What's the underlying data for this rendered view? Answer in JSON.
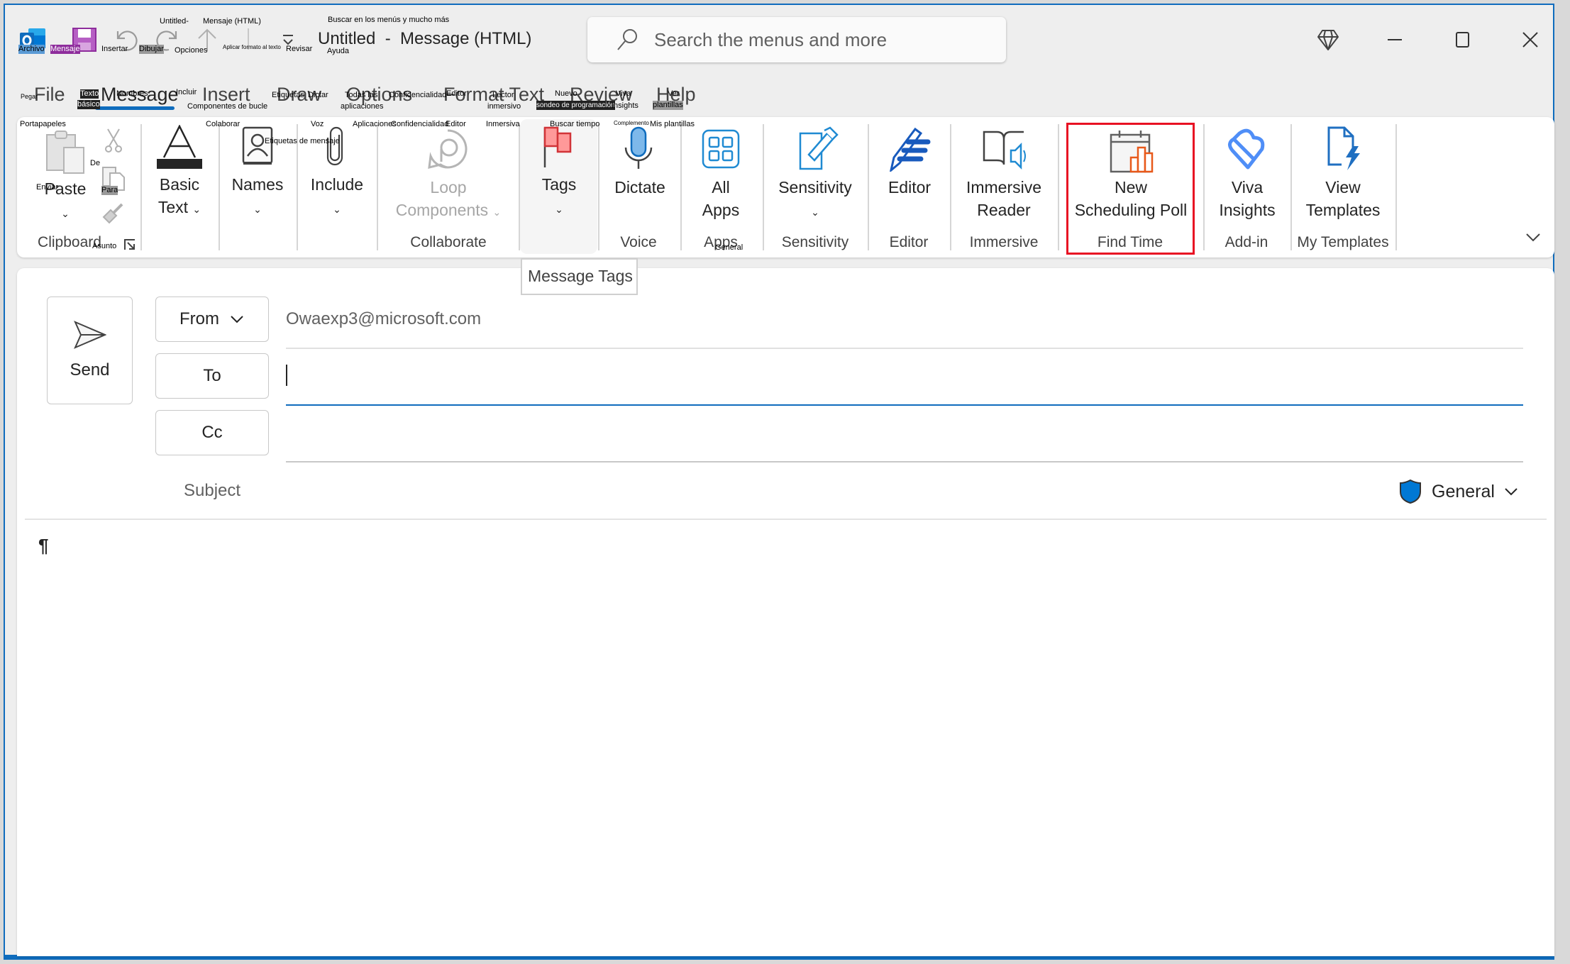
{
  "window": {
    "title": "Untitled  -  Message (HTML)",
    "accent": "#0f6cbd",
    "controls": {
      "premium": "diamond-icon",
      "minimize": "minimize-icon",
      "maximize": "maximize-icon",
      "close": "close-icon"
    }
  },
  "qat": {
    "items": [
      "outlook-logo-icon",
      "save-icon",
      "undo-icon",
      "redo-icon",
      "up-arrow-icon",
      "separator",
      "customize-qat-icon"
    ]
  },
  "search": {
    "placeholder": "Search the menus and more"
  },
  "tabs": [
    {
      "label": "File",
      "selected": false
    },
    {
      "label": "Message",
      "selected": true
    },
    {
      "label": "Insert",
      "selected": false
    },
    {
      "label": "Draw",
      "selected": false
    },
    {
      "label": "Options",
      "selected": false
    },
    {
      "label": "Format Text",
      "selected": false
    },
    {
      "label": "Review",
      "selected": false
    },
    {
      "label": "Help",
      "selected": false
    }
  ],
  "ribbon": {
    "groups": [
      {
        "label": "Clipboard",
        "buttons": [
          {
            "label": "Paste"
          },
          {
            "label": "Cut"
          },
          {
            "label": "Copy"
          },
          {
            "label": "Format Painter"
          }
        ]
      },
      {
        "label": "",
        "buttons": [
          {
            "label": "Basic Text",
            "line1": "Basic",
            "line2": "Text"
          }
        ]
      },
      {
        "label": "",
        "buttons": [
          {
            "label": "Names"
          }
        ]
      },
      {
        "label": "",
        "buttons": [
          {
            "label": "Include"
          }
        ]
      },
      {
        "label": "Collaborate",
        "buttons": [
          {
            "label": "Loop Components",
            "line1": "Loop",
            "line2": "Components",
            "disabled": true
          }
        ]
      },
      {
        "label": "",
        "buttons": [
          {
            "label": "Tags"
          }
        ]
      },
      {
        "label": "Voice",
        "buttons": [
          {
            "label": "Dictate"
          }
        ]
      },
      {
        "label": "Apps",
        "buttons": [
          {
            "label": "All Apps",
            "line1": "All",
            "line2": "Apps"
          }
        ]
      },
      {
        "label": "Sensitivity",
        "buttons": [
          {
            "label": "Sensitivity"
          }
        ]
      },
      {
        "label": "Editor",
        "buttons": [
          {
            "label": "Editor"
          }
        ]
      },
      {
        "label": "Immersive",
        "buttons": [
          {
            "label": "Immersive Reader",
            "line1": "Immersive",
            "line2": "Reader"
          }
        ]
      },
      {
        "label": "Find Time",
        "buttons": [
          {
            "label": "New Scheduling Poll",
            "line1": "New",
            "line2": "Scheduling Poll",
            "highlighted": true
          }
        ]
      },
      {
        "label": "Add-in",
        "buttons": [
          {
            "label": "Viva Insights",
            "line1": "Viva",
            "line2": "Insights"
          }
        ]
      },
      {
        "label": "My Templates",
        "buttons": [
          {
            "label": "View Templates",
            "line1": "View",
            "line2": "Templates"
          }
        ]
      }
    ],
    "tooltip": "Message Tags",
    "highlight_color": "#e81123"
  },
  "compose": {
    "send_label": "Send",
    "from_label": "From",
    "from_value": "Owaexp3@microsoft.com",
    "to_label": "To",
    "to_value": "",
    "cc_label": "Cc",
    "cc_value": "",
    "subject_label": "Subject",
    "subject_value": "",
    "sensitivity_label": "General",
    "body_mark": "¶"
  },
  "overlay_labels": [
    {
      "text": "Archivo",
      "style": "blue"
    },
    {
      "text": "Mensaje",
      "style": "purple"
    },
    {
      "text": "Insertar",
      "style": ""
    },
    {
      "text": "Dibujar",
      "style": "gray"
    },
    {
      "text": "Opciones",
      "style": ""
    },
    {
      "text": "Untitled-",
      "style": ""
    },
    {
      "text": "Mensaje (HTML)",
      "style": ""
    },
    {
      "text": "Aplicar formato al texto",
      "style": ""
    },
    {
      "text": "Revisar",
      "style": ""
    },
    {
      "text": "Ayuda",
      "style": ""
    },
    {
      "text": "Buscar en los menús y mucho más",
      "style": ""
    },
    {
      "text": "Pegar",
      "style": ""
    },
    {
      "text": "Texto",
      "style": "dark"
    },
    {
      "text": "básico",
      "style": "dark"
    },
    {
      "text": "Nombres",
      "style": ""
    },
    {
      "text": "Incluir",
      "style": ""
    },
    {
      "text": "Componentes de bucle",
      "style": ""
    },
    {
      "text": "Etiquetas",
      "style": ""
    },
    {
      "text": "Dictar",
      "style": ""
    },
    {
      "text": "Todas las",
      "style": ""
    },
    {
      "text": "aplicaciones",
      "style": ""
    },
    {
      "text": "Confidencialidad",
      "style": ""
    },
    {
      "text": "Editor",
      "style": ""
    },
    {
      "text": "Lector",
      "style": ""
    },
    {
      "text": "inmersivo",
      "style": ""
    },
    {
      "text": "Nuevo",
      "style": ""
    },
    {
      "text": "sondeo de programación",
      "style": "dark"
    },
    {
      "text": "Viva",
      "style": ""
    },
    {
      "text": "Insights",
      "style": ""
    },
    {
      "text": "Ver",
      "style": ""
    },
    {
      "text": "plantillas",
      "style": "gray"
    },
    {
      "text": "Portapapeles",
      "style": ""
    },
    {
      "text": "Colaborar",
      "style": ""
    },
    {
      "text": "Voz",
      "style": ""
    },
    {
      "text": "Aplicaciones",
      "style": ""
    },
    {
      "text": "Confidencialidad",
      "style": ""
    },
    {
      "text": "Editor",
      "style": ""
    },
    {
      "text": "Inmersiva",
      "style": ""
    },
    {
      "text": "Buscar tiempo",
      "style": ""
    },
    {
      "text": "Complemento",
      "style": ""
    },
    {
      "text": "Mis plantillas",
      "style": ""
    },
    {
      "text": "Etiquetas de mensaje",
      "style": ""
    },
    {
      "text": "De",
      "style": ""
    },
    {
      "text": "Enviar",
      "style": ""
    },
    {
      "text": "Para",
      "style": "gray"
    },
    {
      "text": "Asunto",
      "style": ""
    },
    {
      "text": "General",
      "style": ""
    }
  ]
}
